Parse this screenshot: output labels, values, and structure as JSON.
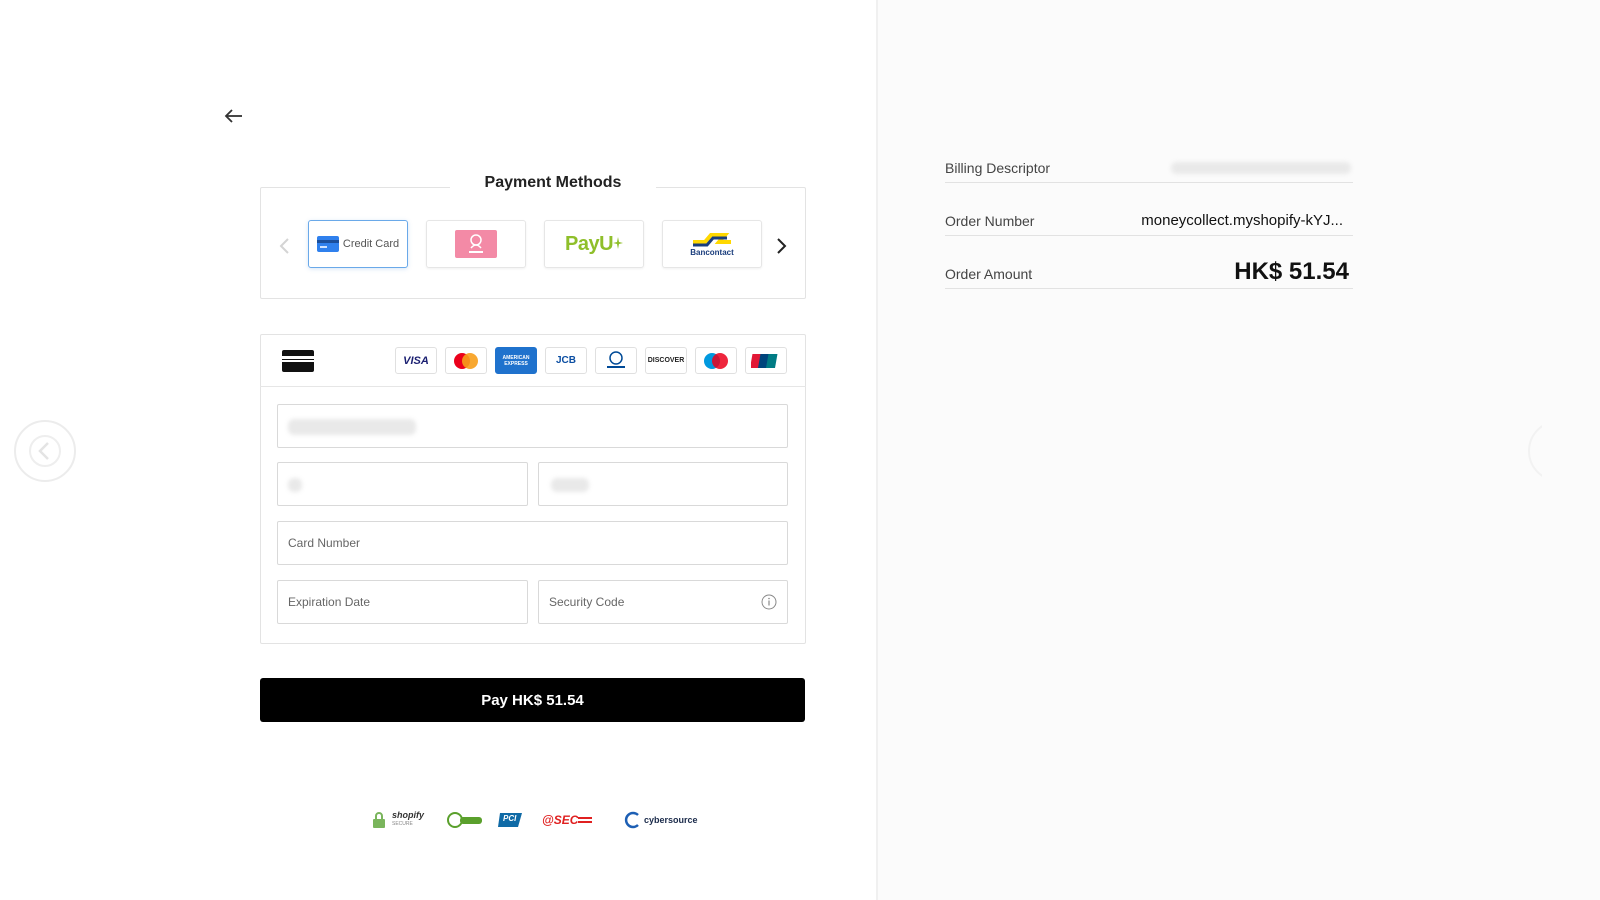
{
  "payment_methods": {
    "title": "Payment Methods",
    "tiles": [
      {
        "label": "Credit Card",
        "active": true,
        "icon": "credit-card-icon"
      },
      {
        "label": "Sofort",
        "active": false,
        "icon": "sofort-logo"
      },
      {
        "label": "PayU",
        "active": false,
        "icon": "payu-logo"
      },
      {
        "label": "Bancontact",
        "active": false,
        "icon": "bancontact-logo"
      }
    ]
  },
  "card_brands": [
    {
      "name": "VISA",
      "color": "#1a1f71",
      "bg": "#ffffff"
    },
    {
      "name": "Mastercard",
      "color": "#eb001b",
      "bg": "#ffffff"
    },
    {
      "name": "AMERICAN EXPRESS",
      "color": "#ffffff",
      "bg": "#1f72cd"
    },
    {
      "name": "JCB",
      "color": "#0b4ea2",
      "bg": "#ffffff"
    },
    {
      "name": "Diners Club",
      "color": "#004a97",
      "bg": "#ffffff"
    },
    {
      "name": "DISCOVER",
      "color": "#222222",
      "bg": "#ffffff"
    },
    {
      "name": "maestro",
      "color": "#0099df",
      "bg": "#ffffff"
    },
    {
      "name": "UnionPay",
      "color": "#e21836",
      "bg": "#ffffff"
    }
  ],
  "form": {
    "card_number_placeholder": "Card Number",
    "expiration_placeholder": "Expiration Date",
    "security_placeholder": "Security Code"
  },
  "pay_button": {
    "label": "Pay HK$ 51.54"
  },
  "trust_badges": [
    {
      "label": "shopify",
      "sub": "SECURE"
    },
    {
      "label": "SECURE"
    },
    {
      "label": "PCI"
    },
    {
      "label": "@SEC"
    },
    {
      "label": "cybersource"
    }
  ],
  "summary": {
    "billing_descriptor_label": "Billing Descriptor",
    "order_number_label": "Order Number",
    "order_number_value": "moneycollect.myshopify-kYJ...",
    "order_amount_label": "Order Amount",
    "order_amount_value": "HK$ 51.54"
  },
  "colors": {
    "accent_border": "#6aa9e9",
    "pay_button_bg": "#000000"
  }
}
